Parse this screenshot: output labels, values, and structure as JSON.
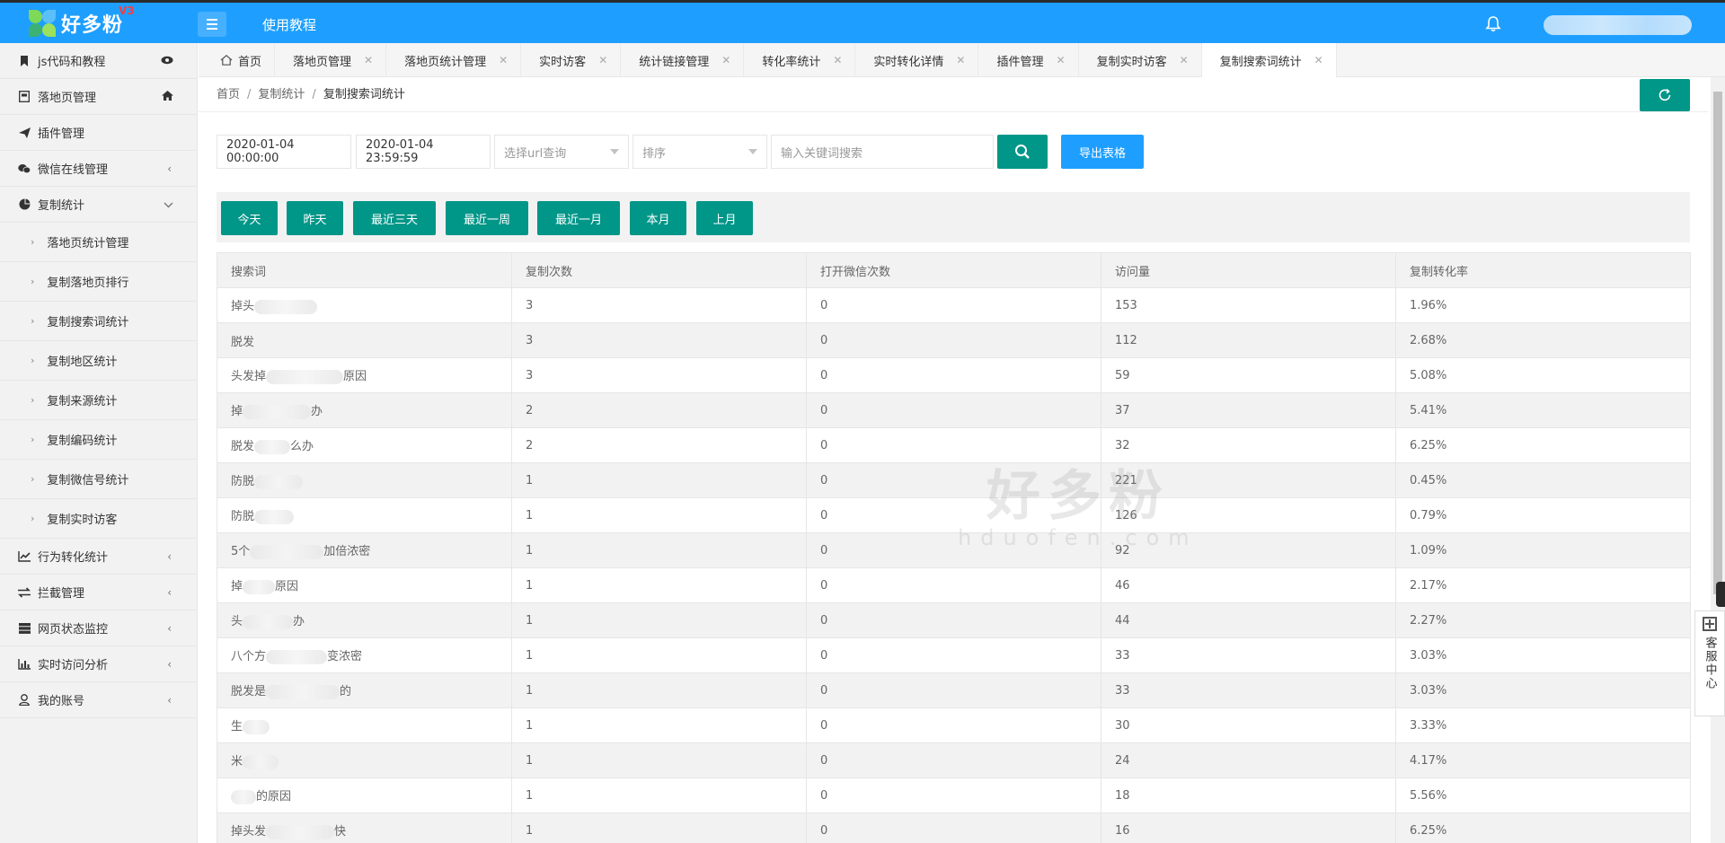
{
  "header": {
    "brand": "好多粉",
    "version": "V3",
    "tutorial_link": "使用教程"
  },
  "sidebar": {
    "items": [
      {
        "label": "js代码和教程",
        "icon": "bookmark-icon",
        "right": "eye-icon"
      },
      {
        "label": "落地页管理",
        "icon": "page-icon",
        "right": "home-icon"
      },
      {
        "label": "插件管理",
        "icon": "send-icon",
        "right": ""
      },
      {
        "label": "微信在线管理",
        "icon": "wechat-icon",
        "right": "chevron-left-icon"
      },
      {
        "label": "复制统计",
        "icon": "pie-chart-icon",
        "right": "chevron-down-icon"
      }
    ],
    "sub_items": [
      "落地页统计管理",
      "复制落地页排行",
      "复制搜索词统计",
      "复制地区统计",
      "复制来源统计",
      "复制编码统计",
      "复制微信号统计",
      "复制实时访客"
    ],
    "bottom_items": [
      {
        "label": "行为转化统计",
        "icon": "line-chart-icon"
      },
      {
        "label": "拦截管理",
        "icon": "swap-icon"
      },
      {
        "label": "网页状态监控",
        "icon": "server-icon"
      },
      {
        "label": "实时访问分析",
        "icon": "bar-chart-icon"
      },
      {
        "label": "我的账号",
        "icon": "user-icon"
      }
    ]
  },
  "tabs": [
    {
      "label": "首页",
      "closable": false
    },
    {
      "label": "落地页管理",
      "closable": true
    },
    {
      "label": "落地页统计管理",
      "closable": true
    },
    {
      "label": "实时访客",
      "closable": true
    },
    {
      "label": "统计链接管理",
      "closable": true
    },
    {
      "label": "转化率统计",
      "closable": true
    },
    {
      "label": "实时转化详情",
      "closable": true
    },
    {
      "label": "插件管理",
      "closable": true
    },
    {
      "label": "复制实时访客",
      "closable": true
    },
    {
      "label": "复制搜索词统计",
      "closable": true,
      "active": true
    }
  ],
  "breadcrumb": [
    "首页",
    "复制统计",
    "复制搜索词统计"
  ],
  "filters": {
    "start_time": "2020-01-04 00:00:00",
    "end_time": "2020-01-04 23:59:59",
    "url_placeholder": "选择url查询",
    "sort_placeholder": "排序",
    "keyword_placeholder": "输入关键词搜索",
    "export_label": "导出表格"
  },
  "quick_ranges": [
    "今天",
    "昨天",
    "最近三天",
    "最近一周",
    "最近一月",
    "本月",
    "上月"
  ],
  "table": {
    "columns": [
      "搜索词",
      "复制次数",
      "打开微信次数",
      "访问量",
      "复制转化率"
    ],
    "rows": [
      {
        "pre": "掉头",
        "post": "",
        "copies": "3",
        "opens": "0",
        "visits": "153",
        "rate": "1.96%",
        "blur": 70
      },
      {
        "pre": "脱发",
        "post": "",
        "copies": "3",
        "opens": "0",
        "visits": "112",
        "rate": "2.68%",
        "blur": 0
      },
      {
        "pre": "头发掉",
        "post": "原因",
        "copies": "3",
        "opens": "0",
        "visits": "59",
        "rate": "5.08%",
        "blur": 86
      },
      {
        "pre": "掉",
        "post": "办",
        "copies": "2",
        "opens": "0",
        "visits": "37",
        "rate": "5.41%",
        "blur": 76
      },
      {
        "pre": "脱发",
        "post": "么办",
        "copies": "2",
        "opens": "0",
        "visits": "32",
        "rate": "6.25%",
        "blur": 40
      },
      {
        "pre": "防脱",
        "post": "",
        "copies": "1",
        "opens": "0",
        "visits": "221",
        "rate": "0.45%",
        "blur": 54
      },
      {
        "pre": "防脱",
        "post": "",
        "copies": "1",
        "opens": "0",
        "visits": "126",
        "rate": "0.79%",
        "blur": 44
      },
      {
        "pre": "5个",
        "post": "加倍浓密",
        "copies": "1",
        "opens": "0",
        "visits": "92",
        "rate": "1.09%",
        "blur": 82
      },
      {
        "pre": "掉",
        "post": "原因",
        "copies": "1",
        "opens": "0",
        "visits": "46",
        "rate": "2.17%",
        "blur": 36
      },
      {
        "pre": "头",
        "post": "办",
        "copies": "1",
        "opens": "0",
        "visits": "44",
        "rate": "2.27%",
        "blur": 56
      },
      {
        "pre": "八个方",
        "post": "变浓密",
        "copies": "1",
        "opens": "0",
        "visits": "33",
        "rate": "3.03%",
        "blur": 68
      },
      {
        "pre": "脱发是",
        "post": "的",
        "copies": "1",
        "opens": "0",
        "visits": "33",
        "rate": "3.03%",
        "blur": 82
      },
      {
        "pre": "生",
        "post": "",
        "copies": "1",
        "opens": "0",
        "visits": "30",
        "rate": "3.33%",
        "blur": 30
      },
      {
        "pre": "米",
        "post": "",
        "copies": "1",
        "opens": "0",
        "visits": "24",
        "rate": "4.17%",
        "blur": 40
      },
      {
        "pre": "",
        "post": "的原因",
        "copies": "1",
        "opens": "0",
        "visits": "18",
        "rate": "5.56%",
        "blur": 28
      },
      {
        "pre": "掉头发",
        "post": "快",
        "copies": "1",
        "opens": "0",
        "visits": "16",
        "rate": "6.25%",
        "blur": 76
      }
    ]
  },
  "watermark": {
    "line1": "好多粉",
    "line2": "hduofen.com"
  },
  "service": {
    "label": "客服中心"
  },
  "colors": {
    "primary": "#1E9FFF",
    "accent": "#009688",
    "sidebar_bg": "#f2f2f2"
  }
}
